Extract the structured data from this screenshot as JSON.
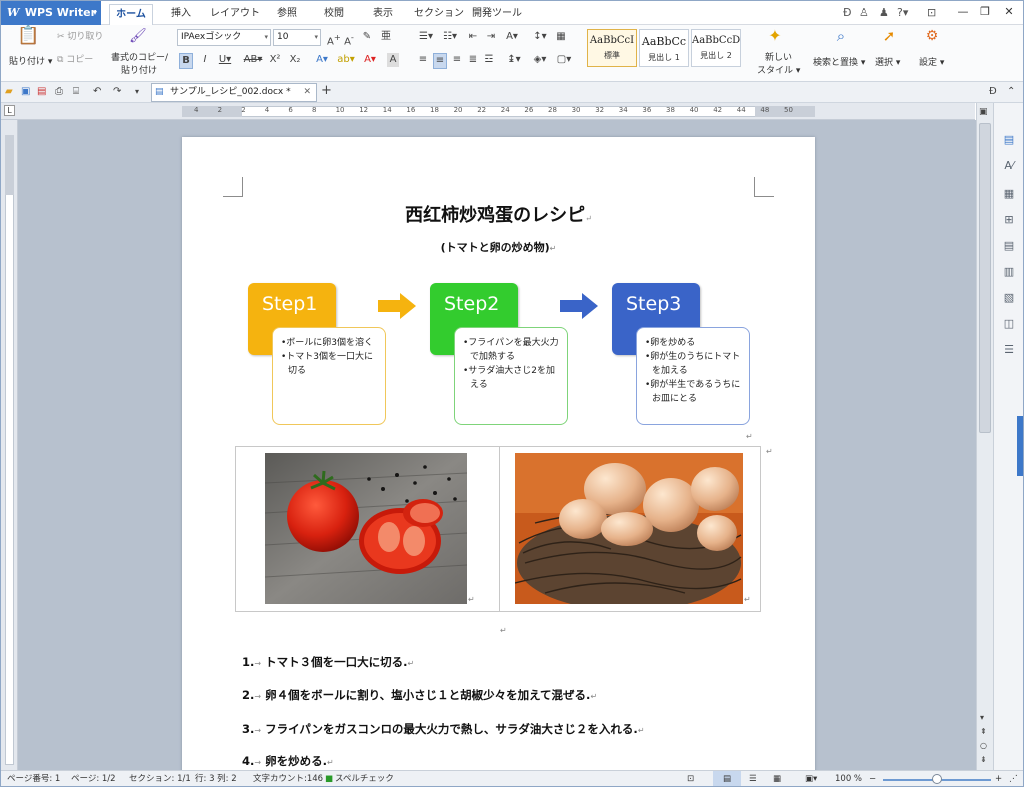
{
  "app": {
    "name": "WPS Writer"
  },
  "menu_tabs": [
    "ホーム",
    "挿入",
    "レイアウト",
    "参照",
    "校閲",
    "表示",
    "セクション",
    "開発ツール"
  ],
  "ribbon": {
    "paste": "貼り付け",
    "cut": "切り取り",
    "copy": "コピー",
    "format_painter_1": "書式のコピー/",
    "format_painter_2": "貼り付け",
    "font_name": "IPAexゴシック",
    "font_size": "10",
    "styles": [
      {
        "preview": "AaBbCcI",
        "name": "標準"
      },
      {
        "preview": "AaBbCc",
        "name": "見出し 1"
      },
      {
        "preview": "AaBbCcD",
        "name": "見出し 2"
      }
    ],
    "new_style_1": "新しい",
    "new_style_2": "スタイル",
    "find_replace": "検索と置換",
    "select": "選択",
    "settings": "設定"
  },
  "doc_tab": {
    "name": "サンプル_レシピ_002.docx *"
  },
  "document": {
    "title": "西红柿炒鸡蛋のレシピ",
    "subtitle": "(トマトと卵の炒め物)",
    "steps": [
      {
        "label": "Step1",
        "items": [
          "ボールに卵3個を溶く",
          "トマト3個を一口大に切る"
        ],
        "color": "#f5b30f",
        "border": "#f0c75a"
      },
      {
        "label": "Step2",
        "items": [
          "フライパンを最大火力で加熱する",
          "サラダ油大さじ2を加える"
        ],
        "color": "#33cc2e",
        "border": "#7fd47a"
      },
      {
        "label": "Step3",
        "items": [
          "卵を炒める",
          "卵が生のうちにトマトを加える",
          "卵が半生であるうちにお皿にとる"
        ],
        "color": "#3a64c8",
        "border": "#8aa4de"
      }
    ],
    "paragraphs": [
      {
        "num": "1.",
        "text": "トマト３個を一口大に切る."
      },
      {
        "num": "2.",
        "text": "卵４個をボールに割り、塩小さじ１と胡椒少々を加えて混ぜる."
      },
      {
        "num": "3.",
        "text": "フライパンをガスコンロの最大火力で熱し、サラダ油大さじ２を入れる."
      },
      {
        "num": "4.",
        "text": "卵を炒める."
      }
    ]
  },
  "status": {
    "page_num": "ページ番号: 1",
    "pages": "ページ: 1/2",
    "section": "セクション: 1/1",
    "row_col": "行: 3  列: 2",
    "word_count": "文字カウント:146",
    "spell": "スペルチェック",
    "zoom": "100 %"
  },
  "ruler_labels_h": [
    "4",
    "2",
    "2",
    "4",
    "6",
    "8",
    "10",
    "12",
    "14",
    "16",
    "18",
    "20",
    "22",
    "24",
    "26",
    "28",
    "30",
    "32",
    "34",
    "36",
    "38",
    "40",
    "42",
    "44",
    "48",
    "50"
  ],
  "colors": {
    "accent": "#3d78c9",
    "workspace": "#b7c1ce"
  }
}
